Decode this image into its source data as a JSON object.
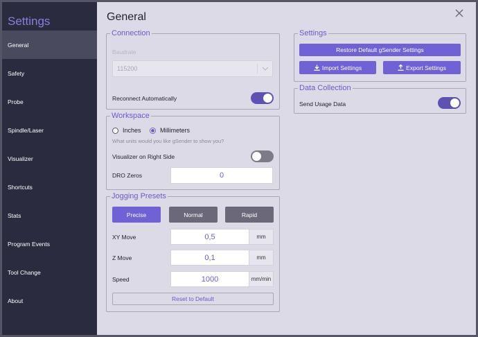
{
  "sidebar": {
    "title": "Settings",
    "items": [
      {
        "label": "General",
        "active": true
      },
      {
        "label": "Safety"
      },
      {
        "label": "Probe"
      },
      {
        "label": "Spindle/Laser"
      },
      {
        "label": "Visualizer"
      },
      {
        "label": "Shortcuts"
      },
      {
        "label": "Stats"
      },
      {
        "label": "Program Events"
      },
      {
        "label": "Tool Change"
      },
      {
        "label": "About"
      }
    ]
  },
  "page": {
    "title": "General",
    "close_icon": "close-icon"
  },
  "connection": {
    "legend": "Connection",
    "baudrate_label": "Baudrate",
    "baudrate_value": "115200",
    "reconnect_label": "Reconnect Automatically",
    "reconnect_on": true
  },
  "workspace": {
    "legend": "Workspace",
    "units": [
      {
        "label": "Inches",
        "checked": false
      },
      {
        "label": "Millimeters",
        "checked": true
      }
    ],
    "units_hint": "What units would you like gSender to show you?",
    "visualizer_right_label": "Visualizer on Right Side",
    "visualizer_right_on": false,
    "dro_zeros_label": "DRO Zeros",
    "dro_zeros_value": "0"
  },
  "jogging": {
    "legend": "Jogging Presets",
    "presets": [
      {
        "label": "Precise",
        "active": true
      },
      {
        "label": "Normal"
      },
      {
        "label": "Rapid"
      }
    ],
    "xy_move_label": "XY Move",
    "xy_move_value": "0,5",
    "xy_move_unit": "mm",
    "z_move_label": "Z Move",
    "z_move_value": "0,1",
    "z_move_unit": "mm",
    "speed_label": "Speed",
    "speed_value": "1000",
    "speed_unit": "mm/min",
    "reset_label": "Reset to Default"
  },
  "settings_box": {
    "legend": "Settings",
    "restore_label": "Restore Default gSender Settings",
    "import_label": "Import Settings",
    "export_label": "Export Settings"
  },
  "data_collection": {
    "legend": "Data Collection",
    "usage_label": "Send Usage Data",
    "usage_on": true
  },
  "colors": {
    "accent": "#7061d6",
    "sidebar": "#2b2b3f",
    "panel": "#dcdae6"
  }
}
